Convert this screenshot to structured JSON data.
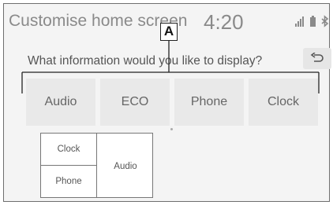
{
  "header": {
    "title": "Customise home screen",
    "time": "4:20"
  },
  "prompt": {
    "question": "What information would you like to display?"
  },
  "callout": {
    "label": "A"
  },
  "options": [
    {
      "label": "Audio"
    },
    {
      "label": "ECO"
    },
    {
      "label": "Phone"
    },
    {
      "label": "Clock"
    }
  ],
  "preview": {
    "top_left": "Clock",
    "bottom_left": "Phone",
    "right": "Audio"
  },
  "icons": {
    "signal": "signal-bars-icon",
    "battery": "battery-icon",
    "bluetooth": "bluetooth-icon",
    "back": "back-arrow-icon"
  }
}
